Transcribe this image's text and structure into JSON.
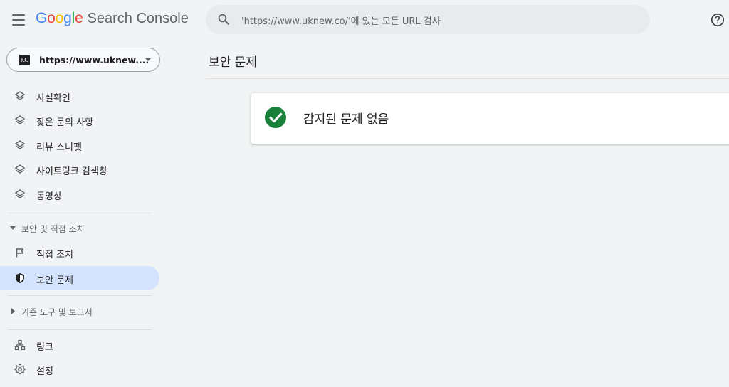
{
  "header": {
    "menu_icon": "hamburger-icon",
    "logo_letters": [
      {
        "char": "G",
        "color": "#4285f4"
      },
      {
        "char": "o",
        "color": "#ea4335"
      },
      {
        "char": "o",
        "color": "#fbbc05"
      },
      {
        "char": "g",
        "color": "#4285f4"
      },
      {
        "char": "l",
        "color": "#34a853"
      },
      {
        "char": "e",
        "color": "#ea4335"
      }
    ],
    "logo_word": "Google",
    "product_name": "Search Console",
    "search_placeholder": "'https://www.uknew.co/'에 있는 모든 URL 검사",
    "help_icon": "help-circle-icon"
  },
  "sidebar": {
    "property": {
      "logo_text": "KC",
      "url": "https://www.uknew...."
    },
    "enhancement_items": [
      {
        "label": "사실확인",
        "icon": "layers-icon"
      },
      {
        "label": "잦은 문의 사항",
        "icon": "layers-icon"
      },
      {
        "label": "리뷰 스니펫",
        "icon": "layers-icon"
      },
      {
        "label": "사이트링크 검색창",
        "icon": "layers-icon"
      },
      {
        "label": "동영상",
        "icon": "layers-icon"
      }
    ],
    "security_section": {
      "label": "보안 및 직접 조치",
      "expanded": true,
      "items": [
        {
          "label": "직접 조치",
          "icon": "flag-icon",
          "active": false
        },
        {
          "label": "보안 문제",
          "icon": "shield-icon",
          "active": true
        }
      ]
    },
    "legacy_section": {
      "label": "기존 도구 및 보고서",
      "expanded": false
    },
    "bottom_items": [
      {
        "label": "링크",
        "icon": "links-icon"
      },
      {
        "label": "설정",
        "icon": "gear-icon"
      }
    ]
  },
  "main": {
    "page_title": "보안 문제",
    "status_message": "감지된 문제 없음",
    "status_icon": "check-circle-icon",
    "status_color": "#188038"
  },
  "colors": {
    "background": "#f1f3f4",
    "active_nav": "#d3e3fd",
    "search_bg": "#e8eaed"
  }
}
